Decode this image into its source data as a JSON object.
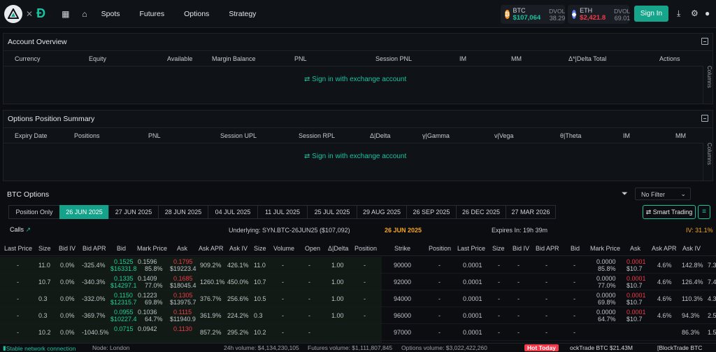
{
  "nav": {
    "items": [
      "Spots",
      "Futures",
      "Options",
      "Strategy"
    ]
  },
  "tickers": [
    {
      "name": "BTC",
      "price": "$107,064",
      "dvol_label": "DVOL",
      "dvol": "38.29",
      "color": "#19c2a0",
      "coin": "#f7931a"
    },
    {
      "name": "ETH",
      "price": "$2,421.8",
      "dvol_label": "DVOL",
      "dvol": "69.01",
      "color": "#f23a4b",
      "coin": "#627eea"
    }
  ],
  "signin": "Sign In",
  "account": {
    "title": "Account Overview",
    "cols": [
      "Currency",
      "Equity",
      "Available",
      "Margin Balance",
      "PNL",
      "Session PNL",
      "IM",
      "MM",
      "Δ*|Delta Total",
      "Actions"
    ],
    "link": "Sign in with exchange account",
    "columns": "Columns"
  },
  "positions": {
    "title": "Options Position Summary",
    "cols": [
      "Expiry Date",
      "Positions",
      "PNL",
      "Session UPL",
      "Session RPL",
      "Δ|Delta",
      "γ|Gamma",
      "ν|Vega",
      "θ|Theta",
      "IM",
      "MM"
    ],
    "link": "Sign in with exchange account",
    "columns": "Columns"
  },
  "btc": {
    "title": "BTC Options",
    "filter": "No Filter",
    "tabs": [
      "Position Only",
      "26 JUN 2025",
      "27 JUN 2025",
      "28 JUN 2025",
      "04 JUL 2025",
      "11 JUL 2025",
      "25 JUL 2025",
      "29 AUG 2025",
      "26 SEP 2025",
      "26 DEC 2025",
      "27 MAR 2026"
    ],
    "smart": "Smart Trading",
    "calls": "Calls",
    "underlying": "Underlying: SYN.BTC-26JUN25 ($107,092)",
    "expiry": "26 JUN 2025",
    "expires_in": "Expires In: 19h 39m",
    "iv": "IV: 31.1%",
    "cols_left": [
      "Last Price",
      "Size",
      "Bid IV",
      "Bid APR",
      "Bid",
      "Mark Price",
      "Ask",
      "Ask APR",
      "Ask IV",
      "Size",
      "Volume",
      "Open",
      "Δ|Delta",
      "Position"
    ],
    "strike": "Strike",
    "cols_right": [
      "Position",
      "Last Price",
      "Size",
      "Bid IV",
      "Bid APR",
      "Bid",
      "Mark Price",
      "Ask",
      "Ask APR",
      "Ask IV"
    ],
    "rows": [
      {
        "last": "-",
        "size": "11.0",
        "biv": "0.0%",
        "bapr": "-325.4%",
        "bid": "0.1525",
        "bidusd": "$16331.8",
        "mark": "0.1596",
        "markp": "85.8%",
        "ask": "0.1795",
        "askusd": "$19223.4",
        "aapr": "909.2%",
        "aiv": "426.1%",
        "asize": "11.0",
        "vol": "-",
        "open": "-",
        "delta": "1.00",
        "pos": "-",
        "strike": "90000",
        "ppos": "-",
        "plast": "0.0001",
        "psize": "-",
        "pbiv": "-",
        "pbapr": "-",
        "pbid": "-",
        "pmark": "0.0000",
        "pmarkp": "85.8%",
        "pask": "0.0001",
        "paskusd": "$10.7",
        "paapr": "4.6%",
        "paiv": "142.8%",
        "pasz": "7.3"
      },
      {
        "last": "-",
        "size": "10.7",
        "biv": "0.0%",
        "bapr": "-340.3%",
        "bid": "0.1335",
        "bidusd": "$14297.1",
        "mark": "0.1409",
        "markp": "77.0%",
        "ask": "0.1685",
        "askusd": "$18045.4",
        "aapr": "1260.1%",
        "aiv": "450.0%",
        "asize": "10.7",
        "vol": "-",
        "open": "-",
        "delta": "1.00",
        "pos": "-",
        "strike": "92000",
        "ppos": "-",
        "plast": "0.0001",
        "psize": "-",
        "pbiv": "-",
        "pbapr": "-",
        "pbid": "-",
        "pmark": "0.0000",
        "pmarkp": "77.0%",
        "pask": "0.0001",
        "paskusd": "$10.7",
        "paapr": "4.6%",
        "paiv": "126.4%",
        "pasz": "7.4"
      },
      {
        "last": "-",
        "size": "0.3",
        "biv": "0.0%",
        "bapr": "-332.0%",
        "bid": "0.1150",
        "bidusd": "$12315.7",
        "mark": "0.1223",
        "markp": "69.8%",
        "ask": "0.1305",
        "askusd": "$13975.7",
        "aapr": "376.7%",
        "aiv": "256.6%",
        "asize": "10.5",
        "vol": "-",
        "open": "-",
        "delta": "1.00",
        "pos": "-",
        "strike": "94000",
        "ppos": "-",
        "plast": "0.0001",
        "psize": "-",
        "pbiv": "-",
        "pbapr": "-",
        "pbid": "-",
        "pmark": "0.0000",
        "pmarkp": "69.8%",
        "pask": "0.0001",
        "paskusd": "$10.7",
        "paapr": "4.6%",
        "paiv": "110.3%",
        "pasz": "4.3"
      },
      {
        "last": "-",
        "size": "0.3",
        "biv": "0.0%",
        "bapr": "-369.7%",
        "bid": "0.0955",
        "bidusd": "$10227.4",
        "mark": "0.1036",
        "markp": "64.7%",
        "ask": "0.1115",
        "askusd": "$11940.9",
        "aapr": "361.9%",
        "aiv": "224.2%",
        "asize": "0.3",
        "vol": "-",
        "open": "-",
        "delta": "1.00",
        "pos": "-",
        "strike": "96000",
        "ppos": "-",
        "plast": "0.0001",
        "psize": "-",
        "pbiv": "-",
        "pbapr": "-",
        "pbid": "-",
        "pmark": "0.0000",
        "pmarkp": "64.7%",
        "pask": "0.0001",
        "paskusd": "$10.7",
        "paapr": "4.6%",
        "paiv": "94.3%",
        "pasz": "2.5"
      },
      {
        "last": "-",
        "size": "10.2",
        "biv": "0.0%",
        "bapr": "-1040.5%",
        "bid": "0.0715",
        "bidusd": "",
        "mark": "0.0942",
        "markp": "",
        "ask": "0.1130",
        "askusd": "",
        "aapr": "857.2%",
        "aiv": "295.2%",
        "asize": "10.2",
        "vol": "-",
        "open": "-",
        "delta": "",
        "pos": "",
        "strike": "97000",
        "ppos": "-",
        "plast": "0.0001",
        "psize": "-",
        "pbiv": "-",
        "pbapr": "-",
        "pbid": "-",
        "pmark": "",
        "pmarkp": "",
        "pask": "",
        "paskusd": "",
        "paapr": "",
        "paiv": "86.3%",
        "pasz": "1.5"
      }
    ]
  },
  "status": {
    "conn": "Stable network connection",
    "node": "Node: London",
    "v24": "24h volume: $4,134,230,105",
    "fut": "Futures volume: $1,111,807,845",
    "opt": "Options volume: $3,022,422,260",
    "hot": "Hot Today",
    "t1": "ockTrade BTC $21.43M",
    "t2": "[BlockTrade BTC"
  }
}
